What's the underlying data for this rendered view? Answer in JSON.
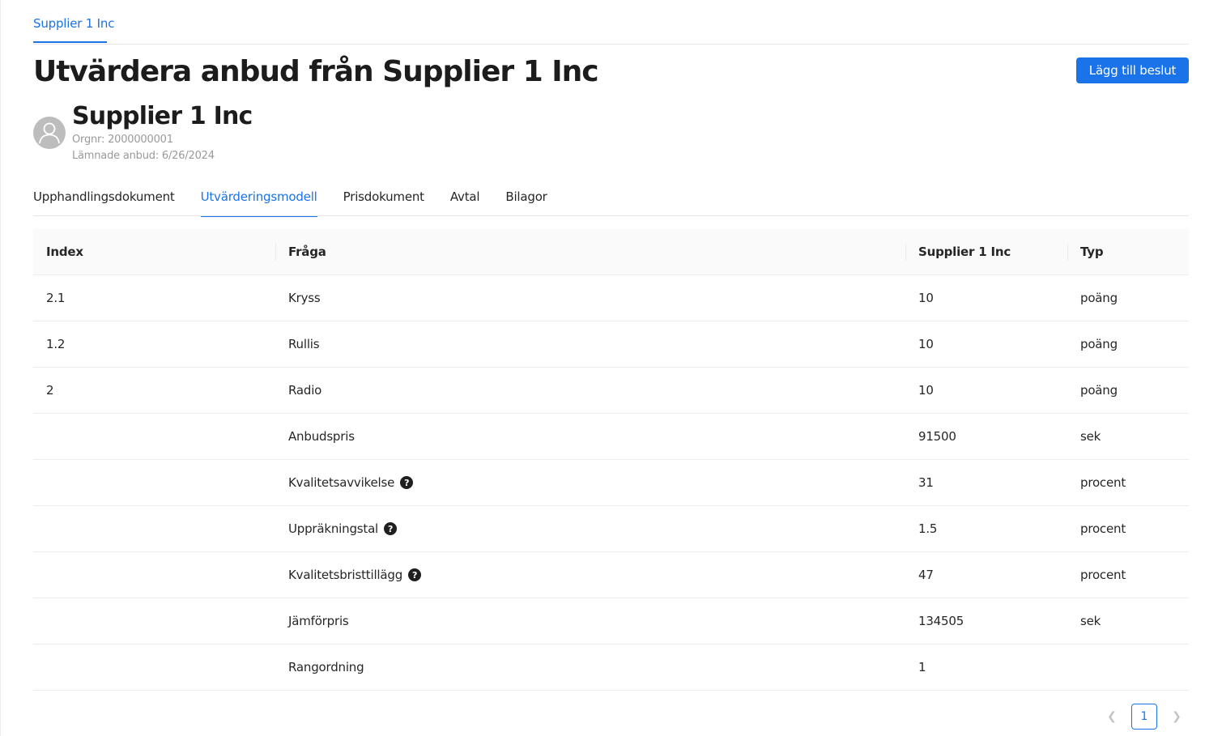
{
  "breadcrumb": {
    "label": "Supplier 1 Inc"
  },
  "page_title": "Utvärdera anbud från Supplier 1 Inc",
  "primary_action": {
    "label": "Lägg till beslut"
  },
  "supplier": {
    "name": "Supplier 1 Inc",
    "orgnr": "Orgnr: 2000000001",
    "submitted": "Lämnade anbud: 6/26/2024"
  },
  "tabs": [
    {
      "label": "Upphandlingsdokument",
      "active": false
    },
    {
      "label": "Utvärderingsmodell",
      "active": true
    },
    {
      "label": "Prisdokument",
      "active": false
    },
    {
      "label": "Avtal",
      "active": false
    },
    {
      "label": "Bilagor",
      "active": false
    }
  ],
  "table": {
    "headers": {
      "index": "Index",
      "question": "Fråga",
      "supplier": "Supplier 1 Inc",
      "type": "Typ"
    },
    "rows": [
      {
        "index": "2.1",
        "question": "Kryss",
        "value": "10",
        "type": "poäng",
        "help": false
      },
      {
        "index": "1.2",
        "question": "Rullis",
        "value": "10",
        "type": "poäng",
        "help": false
      },
      {
        "index": "2",
        "question": "Radio",
        "value": "10",
        "type": "poäng",
        "help": false
      },
      {
        "index": "",
        "question": "Anbudspris",
        "value": "91500",
        "type": "sek",
        "help": false
      },
      {
        "index": "",
        "question": "Kvalitetsavvikelse",
        "value": "31",
        "type": "procent",
        "help": true
      },
      {
        "index": "",
        "question": "Uppräkningstal",
        "value": "1.5",
        "type": "procent",
        "help": true
      },
      {
        "index": "",
        "question": "Kvalitetsbristtillägg",
        "value": "47",
        "type": "procent",
        "help": true
      },
      {
        "index": "",
        "question": "Jämförpris",
        "value": "134505",
        "type": "sek",
        "help": false
      },
      {
        "index": "",
        "question": "Rangordning",
        "value": "1",
        "type": "",
        "help": false
      }
    ]
  },
  "pagination": {
    "current": "1",
    "prev_icon": "chevron-left-icon",
    "next_icon": "chevron-right-icon"
  },
  "colors": {
    "accent": "#1a73e8",
    "header_bg": "#fafafa",
    "border": "#ededed"
  }
}
